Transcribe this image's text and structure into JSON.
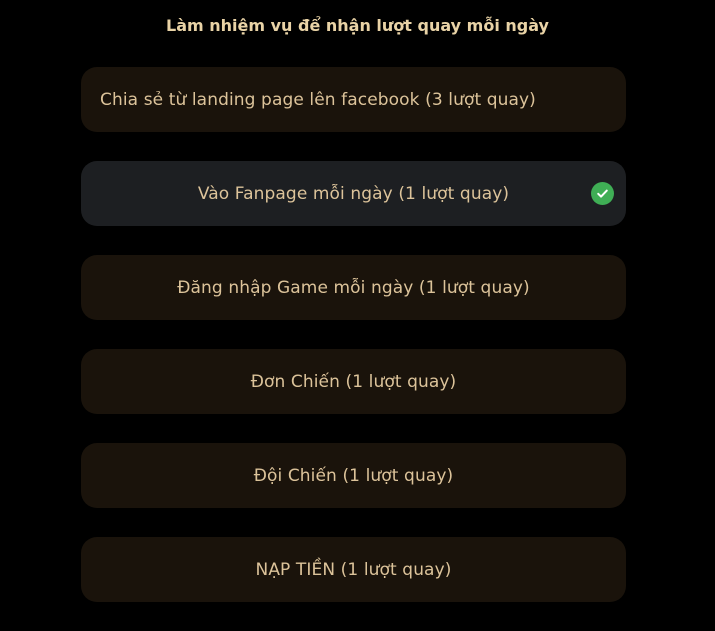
{
  "heading": "Làm nhiệm vụ để nhận lượt quay mỗi ngày",
  "tasks": [
    {
      "label": "Chia sẻ từ landing page lên facebook (3 lượt quay)",
      "completed": false
    },
    {
      "label": "Vào Fanpage mỗi ngày (1 lượt quay)",
      "completed": true
    },
    {
      "label": "Đăng nhập Game mỗi ngày (1 lượt quay)",
      "completed": false
    },
    {
      "label": "Đơn Chiến (1 lượt quay)",
      "completed": false
    },
    {
      "label": "Đội Chiến (1 lượt quay)",
      "completed": false
    },
    {
      "label": "NẠP TIỀN (1 lượt quay)",
      "completed": false
    }
  ],
  "icons": {
    "completed": "check-circle-icon"
  },
  "colors": {
    "background": "#000000",
    "heading_text": "#e9d3a6",
    "task_text": "#dcc39a",
    "task_background": "#1a130b",
    "task_completed_background": "#1d1f22",
    "check_green": "#3fae55"
  }
}
